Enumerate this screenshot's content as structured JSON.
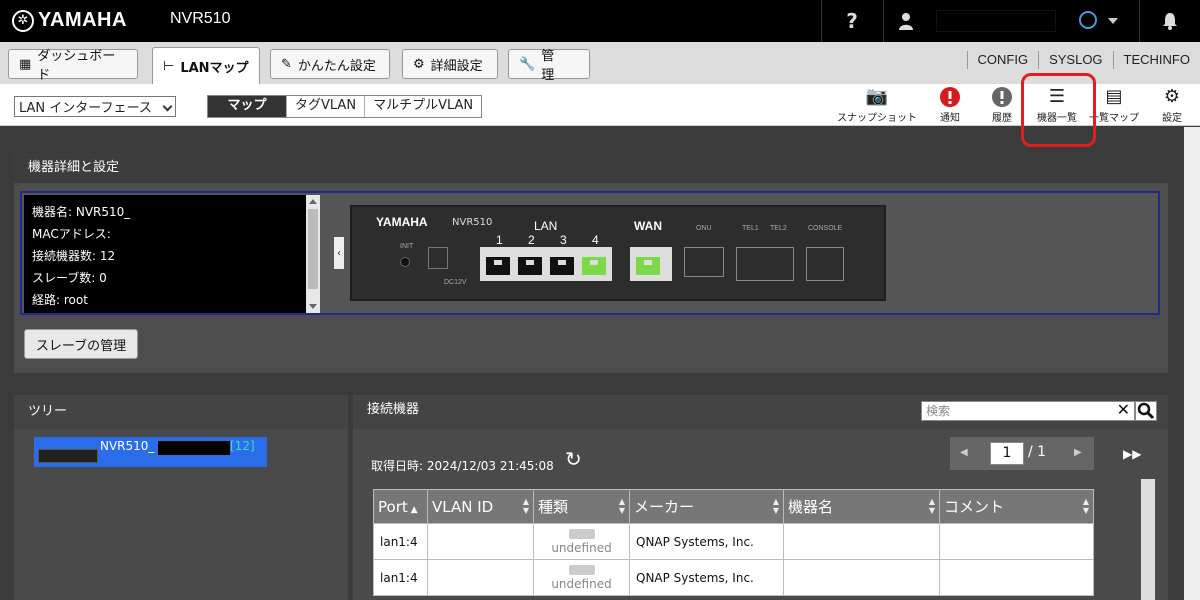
{
  "header": {
    "brand": "YAMAHA",
    "model": "NVR510",
    "help_label": "?"
  },
  "tabs": [
    {
      "label": "ダッシュボード",
      "icon": "dashboard-icon"
    },
    {
      "label": "LANマップ",
      "icon": "lan-map-icon"
    },
    {
      "label": "かんたん設定",
      "icon": "wand-icon"
    },
    {
      "label": "詳細設定",
      "icon": "gear-icon"
    },
    {
      "label": "管　理",
      "icon": "wrench-icon"
    }
  ],
  "right_links": [
    "CONFIG",
    "SYSLOG",
    "TECHINFO"
  ],
  "toolbar": {
    "interface_select": "LAN インターフェース",
    "view_tabs": [
      "マップ",
      "タグVLAN",
      "マルチプルVLAN"
    ],
    "tools": [
      {
        "label": "スナップショット",
        "icon": "camera-icon"
      },
      {
        "label": "通知",
        "icon": "alert-icon"
      },
      {
        "label": "履歴",
        "icon": "history-icon"
      },
      {
        "label": "機器一覧",
        "icon": "list-icon"
      },
      {
        "label": "一覧マップ",
        "icon": "map-list-icon"
      },
      {
        "label": "設定",
        "icon": "gear-icon"
      }
    ]
  },
  "detail": {
    "title": "機器詳細と設定",
    "info": [
      "機器名: NVR510_",
      "MACアドレス:",
      "接続機器数: 12",
      "スレーブ数: 0",
      "経路: root"
    ],
    "device_brand": "YAMAHA",
    "device_model": "NVR510",
    "lan_label": "LAN",
    "lan_ports": [
      "1",
      "2",
      "3",
      "4"
    ],
    "wan_label": "WAN",
    "onu_label": "ONU",
    "tel1_label": "TEL1",
    "tel2_label": "TEL2",
    "console_label": "CONSOLE",
    "init_label": "INIT",
    "dc_label": "DC12V",
    "slave_button": "スレーブの管理"
  },
  "tree": {
    "title": "ツリー",
    "item_name": "NVR510_",
    "item_count": "[12]"
  },
  "connected": {
    "title": "接続機器",
    "search_placeholder": "検索",
    "fetched_at": "取得日時: 2024/12/03 21:45:08",
    "page_current": "1",
    "page_total": "/ 1",
    "columns": [
      "Port",
      "VLAN ID",
      "種類",
      "メーカー",
      "機器名",
      "コメント"
    ],
    "rows": [
      {
        "port": "lan1:4",
        "vlan": "",
        "type": "undefined",
        "maker": "QNAP Systems, Inc.",
        "name": "",
        "comment": ""
      },
      {
        "port": "lan1:4",
        "vlan": "",
        "type": "undefined",
        "maker": "QNAP Systems, Inc.",
        "name": "",
        "comment": ""
      }
    ]
  },
  "colors": {
    "highlight": "#e02020",
    "tree_selected": "#2b6de8",
    "port_active": "#7dd84a"
  }
}
